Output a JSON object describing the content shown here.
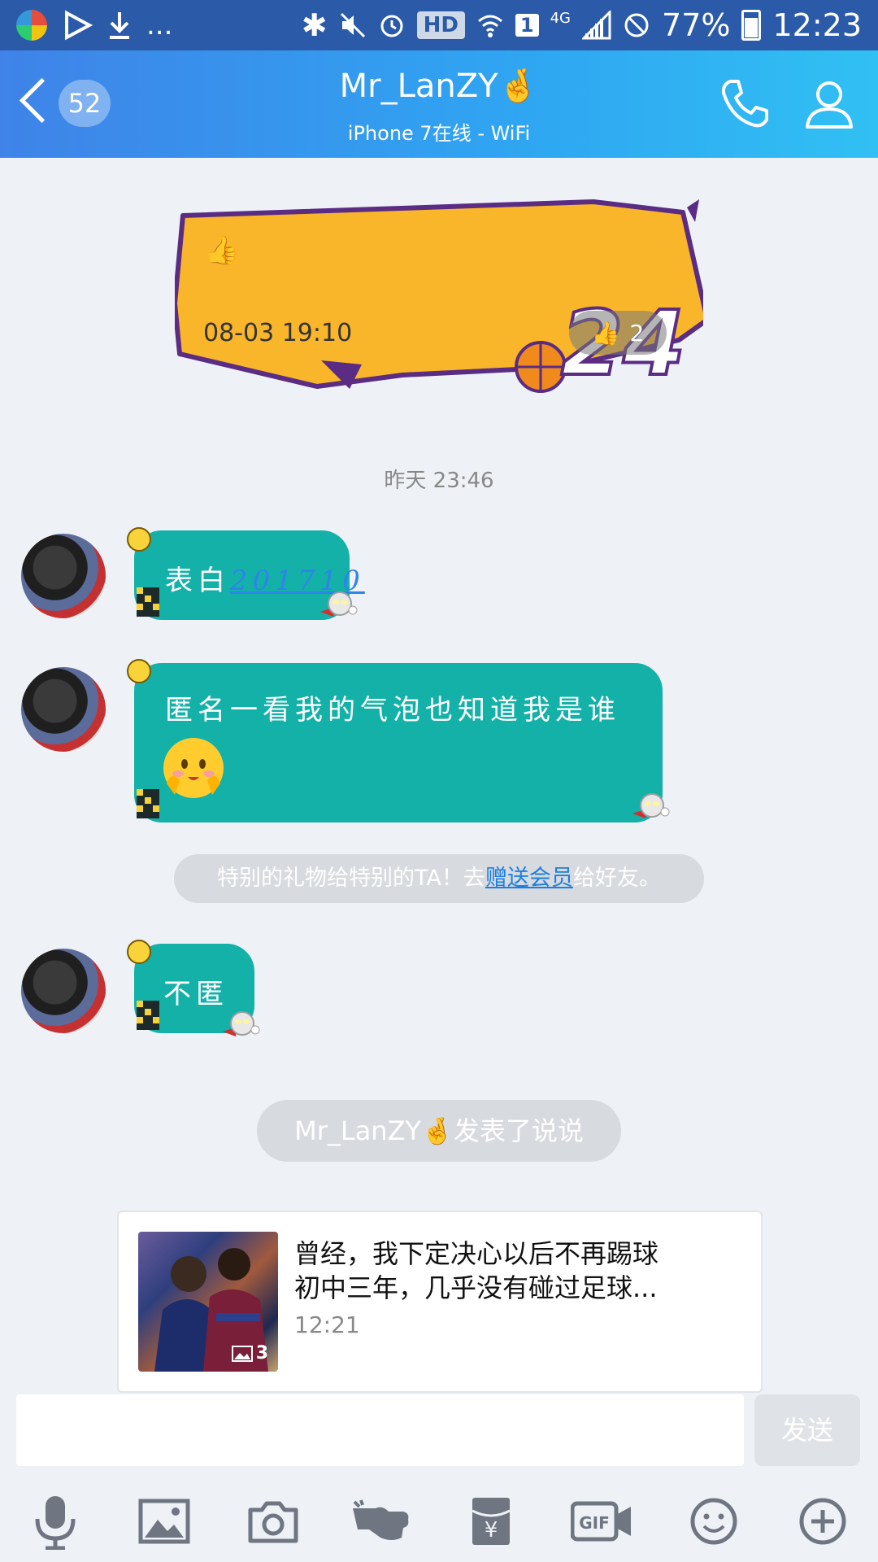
{
  "status_bar": {
    "battery": "77%",
    "time": "12:23",
    "network": "4G",
    "hd": "HD",
    "sim": "1",
    "more": "..."
  },
  "header": {
    "unread_count": "52",
    "title": "Mr_LanZY🤞",
    "subtitle": "iPhone 7在线 - WiFi"
  },
  "like_card": {
    "timestamp": "08-03 19:10",
    "like_count": "2",
    "number_art": "24"
  },
  "time_divider": "昨天 23:46",
  "messages": [
    {
      "text": "表白",
      "link": "201710"
    },
    {
      "text": "匿名一看我的气泡也知道我是谁"
    },
    {
      "text": "不匿"
    }
  ],
  "gift_notice": {
    "prefix": "特别的礼物给特别的TA！去",
    "link": "赠送会员",
    "suffix": "给好友。"
  },
  "post_notice": "Mr_LanZY🤞发表了说说",
  "post_card": {
    "line1": "曾经，我下定决心以后不再踢球",
    "line2": "初中三年，几乎没有碰过足球...",
    "time": "12:21",
    "image_count": "3"
  },
  "input": {
    "placeholder": "",
    "send_label": "发送"
  },
  "toolbar": [
    "mic-icon",
    "image-icon",
    "camera-icon",
    "poke-icon",
    "red-packet-icon",
    "gif-icon",
    "emoji-icon",
    "plus-icon"
  ]
}
